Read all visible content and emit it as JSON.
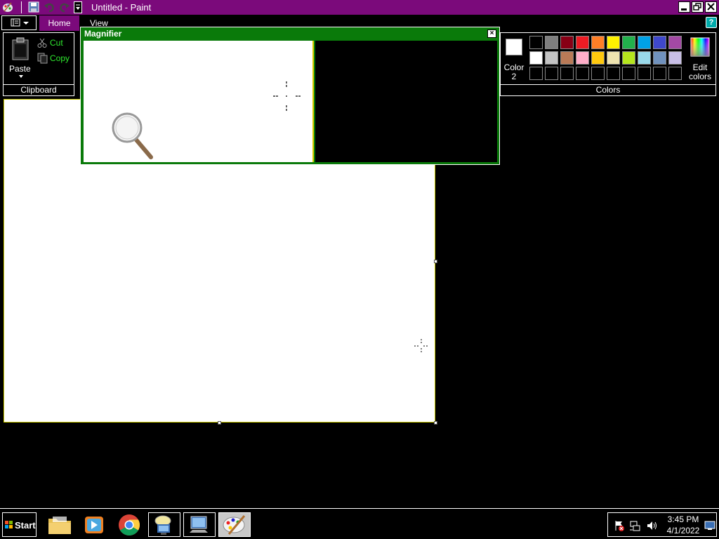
{
  "window": {
    "title": "Untitled - Paint"
  },
  "tabs": {
    "home": "Home",
    "view": "View"
  },
  "clipboard": {
    "paste": "Paste",
    "cut": "Cut",
    "copy": "Copy",
    "group": "Clipboard"
  },
  "colors": {
    "color2_line1": "Color",
    "color2_line2": "2",
    "edit_line1": "Edit",
    "edit_line2": "colors",
    "group": "Colors",
    "row1": [
      "#000000",
      "#7f7f7f",
      "#880015",
      "#ed1c24",
      "#ff7f27",
      "#fff200",
      "#22b14c",
      "#00a2e8",
      "#3f48cc",
      "#a349a4"
    ],
    "row2": [
      "#ffffff",
      "#c3c3c3",
      "#b97a57",
      "#ffaec9",
      "#ffc90e",
      "#efe4b0",
      "#b5e61d",
      "#99d9ea",
      "#7092be",
      "#c8bfe7"
    ],
    "row3": [
      "#000000",
      "#000000",
      "#000000",
      "#000000",
      "#000000",
      "#000000",
      "#000000",
      "#000000",
      "#000000",
      "#000000"
    ]
  },
  "magnifier": {
    "title": "Magnifier",
    "close": "×"
  },
  "taskbar": {
    "start": "Start",
    "time": "3:45 PM",
    "date": "4/1/2022"
  },
  "theme": {
    "accent": "#7b0a7b",
    "magnifier": "#0a7a0a"
  }
}
